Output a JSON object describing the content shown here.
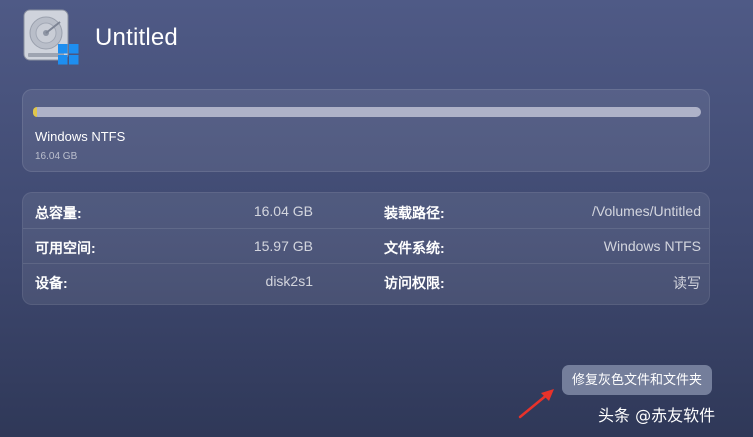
{
  "volume": {
    "title": "Untitled",
    "filesystem_label": "Windows NTFS",
    "size": "16.04 GB",
    "used_fraction": 0.0044
  },
  "info": {
    "rows": [
      {
        "k1": "总容量:",
        "v1": "16.04 GB",
        "k2": "装载路径:",
        "v2": "/Volumes/Untitled"
      },
      {
        "k1": "可用空间:",
        "v1": "15.97 GB",
        "k2": "文件系统:",
        "v2": "Windows NTFS"
      },
      {
        "k1": "设备:",
        "v1": "disk2s1",
        "k2": "访问权限:",
        "v2": "读写"
      }
    ]
  },
  "actions": {
    "repair_button": "修复灰色文件和文件夹"
  },
  "watermark": {
    "text": "头条 @赤友软件"
  },
  "colors": {
    "usage_fill": "#e0c64a",
    "arrow": "#e8322a",
    "windows_logo": "#1e8ef0"
  },
  "icons": {
    "disk": "disk-drive-icon",
    "badge": "windows-logo-icon",
    "annotation": "red-arrow-icon"
  }
}
